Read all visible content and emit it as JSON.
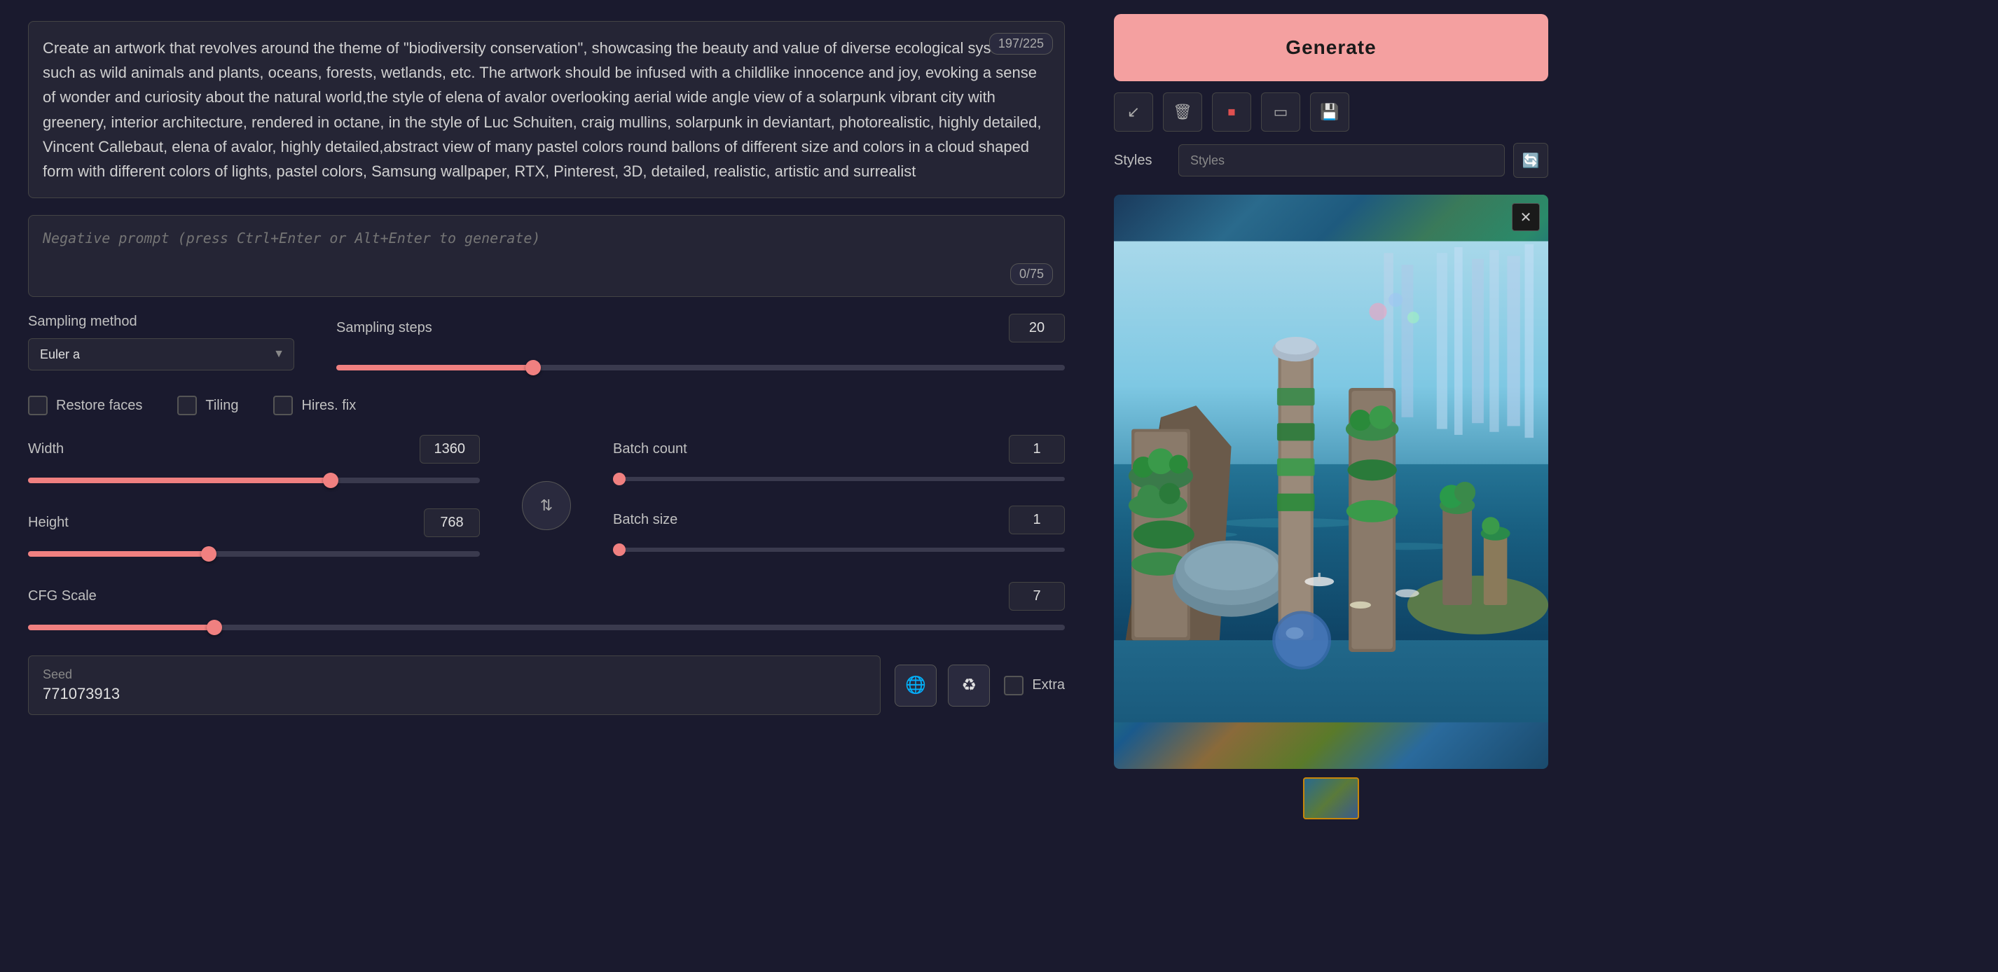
{
  "prompt": {
    "text": "Create an artwork that revolves around the theme of \"biodiversity conservation\", showcasing the beauty and value of diverse ecological systems such as wild animals and plants, oceans, forests, wetlands, etc. The artwork should be infused with a childlike innocence and joy, evoking a sense of wonder and curiosity about the natural world,the style of elena of avalor overlooking aerial wide angle view of a solarpunk vibrant city with greenery, interior architecture, rendered in octane, in the style of Luc Schuiten, craig mullins, solarpunk in deviantart, photorealistic, highly detailed, Vincent Callebaut, elena of avalor, highly detailed,abstract view of many pastel colors round ballons of different size and colors in a cloud shaped form with different colors of lights, pastel colors, Samsung wallpaper, RTX, Pinterest, 3D, detailed, realistic, artistic and surrealist",
    "char_count": "197/225"
  },
  "negative_prompt": {
    "placeholder": "Negative prompt (press Ctrl+Enter or Alt+Enter to generate)",
    "char_count": "0/75"
  },
  "sampling": {
    "method_label": "Sampling method",
    "method_value": "Euler a",
    "steps_label": "Sampling steps",
    "steps_value": "20",
    "steps_percent": 27
  },
  "checkboxes": {
    "restore_faces": {
      "label": "Restore faces",
      "checked": false
    },
    "tiling": {
      "label": "Tiling",
      "checked": false
    },
    "hires_fix": {
      "label": "Hires. fix",
      "checked": false
    }
  },
  "dimensions": {
    "width_label": "Width",
    "width_value": "1360",
    "width_percent": 67,
    "height_label": "Height",
    "height_value": "768",
    "height_percent": 40,
    "swap_icon": "⇅"
  },
  "batch": {
    "count_label": "Batch count",
    "count_value": "1",
    "count_percent": 2,
    "size_label": "Batch size",
    "size_value": "1",
    "size_percent": 2
  },
  "cfg": {
    "label": "CFG Scale",
    "value": "7",
    "percent": 18
  },
  "seed": {
    "label": "Seed",
    "value": "771073913",
    "random_icon": "🌐",
    "recycle_icon": "♻",
    "extra_label": "Extra"
  },
  "right_panel": {
    "generate_label": "Generate",
    "toolbar": {
      "undo_icon": "↙",
      "trash_icon": "🗑",
      "stop_icon": "⏹",
      "skip_icon": "▭",
      "save_icon": "💾"
    },
    "styles_label": "Styles",
    "styles_placeholder": "Styles",
    "close_icon": "✕"
  },
  "colors": {
    "accent": "#f08080",
    "generate_bg": "#f4a0a0",
    "bg": "#1a1a2e",
    "panel": "#252535",
    "thumbnail_border": "#c8860a"
  }
}
